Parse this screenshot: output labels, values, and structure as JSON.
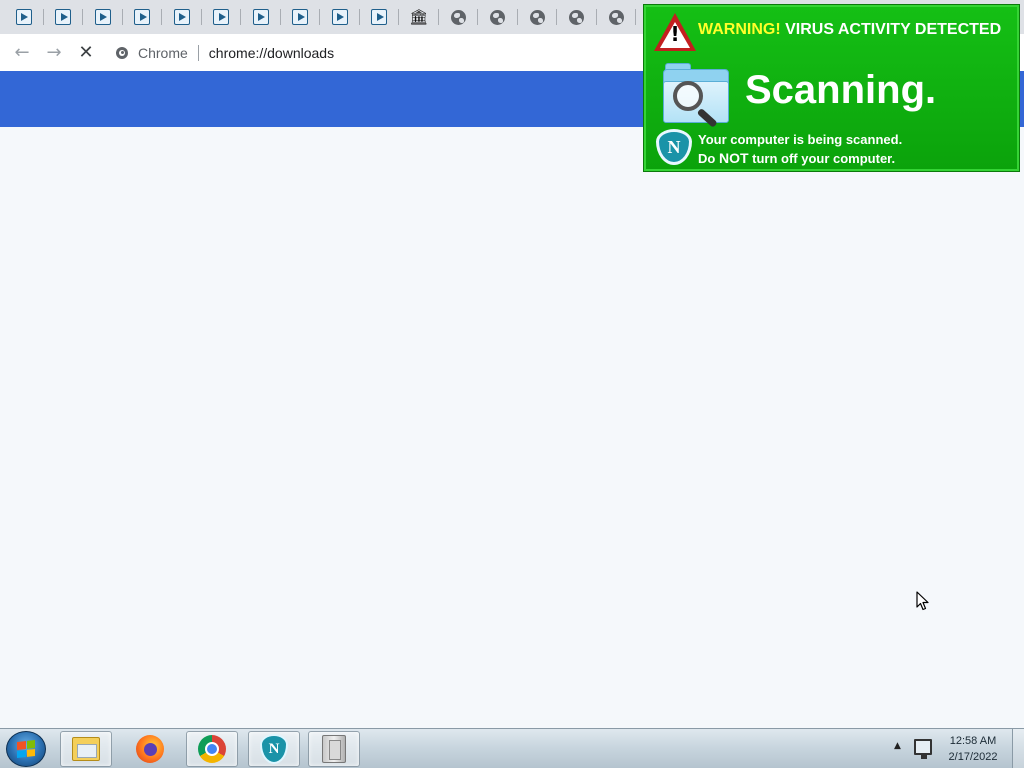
{
  "browser": {
    "tabs": [
      {
        "icon": "play-icon"
      },
      {
        "icon": "play-icon"
      },
      {
        "icon": "play-icon"
      },
      {
        "icon": "play-icon"
      },
      {
        "icon": "play-icon"
      },
      {
        "icon": "play-icon"
      },
      {
        "icon": "play-icon"
      },
      {
        "icon": "play-icon"
      },
      {
        "icon": "play-icon"
      },
      {
        "icon": "play-icon"
      },
      {
        "icon": "bank-icon"
      },
      {
        "icon": "globe-icon"
      },
      {
        "icon": "globe-icon"
      },
      {
        "icon": "globe-icon"
      },
      {
        "icon": "globe-icon"
      },
      {
        "icon": "globe-icon"
      }
    ],
    "toolbar": {
      "back_icon": "←",
      "forward_icon": "→",
      "stop_icon": "✕",
      "site_label": "Chrome",
      "url": "chrome://downloads"
    },
    "header_color": "#3367d6"
  },
  "popup": {
    "warning_prefix": "WARNING!",
    "warning_text": " VIRUS ACTIVITY DETECTED",
    "title": "Scanning.",
    "message_line1": "Your computer is being scanned.",
    "message_line2_a": "Do ",
    "message_line2_b": "NOT",
    "message_line2_c": " turn off your computer.",
    "shield_letter": "N",
    "background_color": "#0db80d"
  },
  "taskbar": {
    "items": [
      "explorer-icon",
      "firefox-icon",
      "chrome-icon",
      "shield-icon",
      "installer-icon"
    ],
    "clock_time": "12:58 AM",
    "clock_date": "2/17/2022",
    "tray_arrow": "▲"
  }
}
